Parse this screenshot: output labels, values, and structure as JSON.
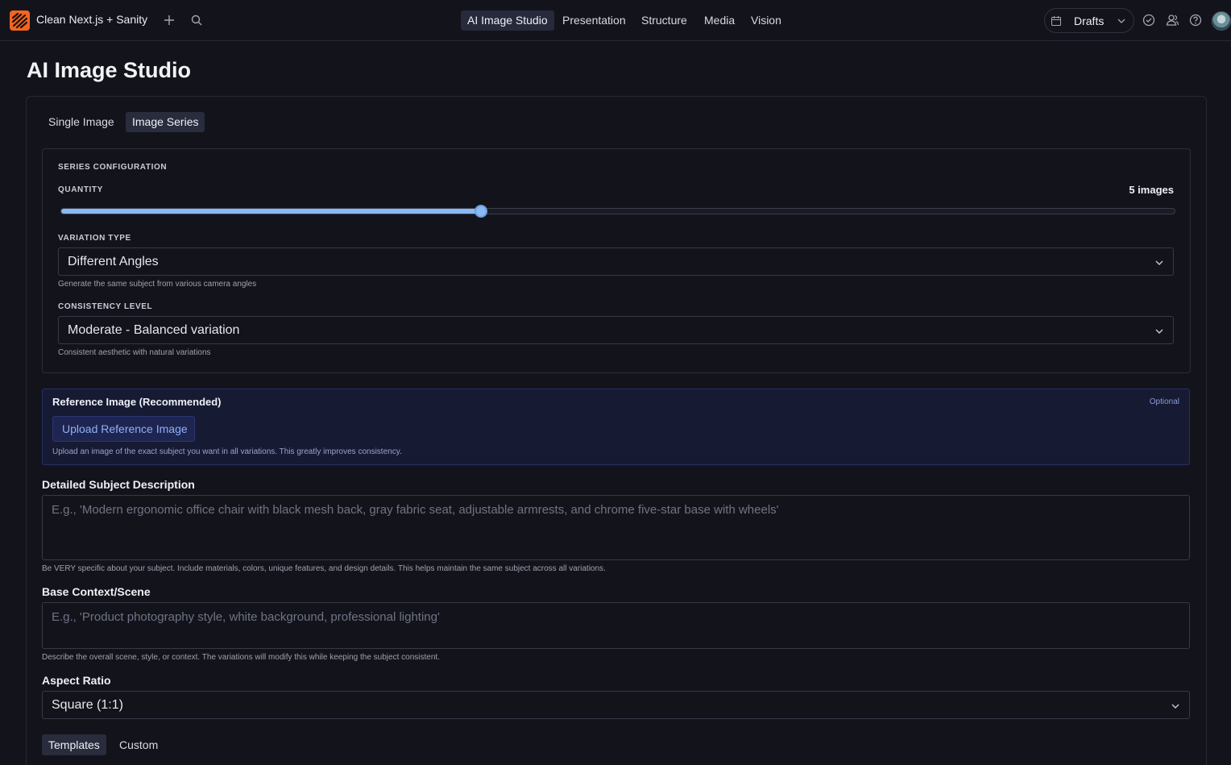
{
  "header": {
    "app_title": "Clean Next.js + Sanity",
    "nav": [
      "AI Image Studio",
      "Presentation",
      "Structure",
      "Media",
      "Vision"
    ],
    "active_nav": "AI Image Studio",
    "drafts_label": "Drafts",
    "icons": [
      "add-icon",
      "search-icon",
      "calendar-icon",
      "chevron-down-icon",
      "check-circle-icon",
      "users-icon",
      "help-icon",
      "avatar"
    ]
  },
  "page": {
    "title": "AI Image Studio"
  },
  "tabs": [
    "Single Image",
    "Image Series"
  ],
  "active_tab": "Image Series",
  "series_config": {
    "heading": "SERIES CONFIGURATION",
    "quantity_label": "QUANTITY",
    "quantity_value": "5 images",
    "slider_fraction": 0.377,
    "variation_label": "VARIATION TYPE",
    "variation_value": "Different Angles",
    "variation_hint": "Generate the same subject from various camera angles",
    "consistency_label": "CONSISTENCY LEVEL",
    "consistency_value": "Moderate - Balanced variation",
    "consistency_hint": "Consistent aesthetic with natural variations"
  },
  "reference": {
    "title": "Reference Image (Recommended)",
    "optional": "Optional",
    "upload_label": "Upload Reference Image",
    "hint": "Upload an image of the exact subject you want in all variations. This greatly improves consistency."
  },
  "subject": {
    "label": "Detailed Subject Description",
    "placeholder": "E.g., 'Modern ergonomic office chair with black mesh back, gray fabric seat, adjustable armrests, and chrome five-star base with wheels'",
    "hint": "Be VERY specific about your subject. Include materials, colors, unique features, and design details. This helps maintain the same subject across all variations."
  },
  "context": {
    "label": "Base Context/Scene",
    "placeholder": "E.g., 'Product photography style, white background, professional lighting'",
    "hint": "Describe the overall scene, style, or context. The variations will modify this while keeping the subject consistent."
  },
  "aspect": {
    "label": "Aspect Ratio",
    "value": "Square (1:1)"
  },
  "prompt_tabs": [
    "Templates",
    "Custom"
  ],
  "active_prompt_tab": "Templates",
  "colors": {
    "accent": "#8ab8f2",
    "brand": "#f36421",
    "background": "#13141b",
    "reference_bg": "#161a33"
  }
}
